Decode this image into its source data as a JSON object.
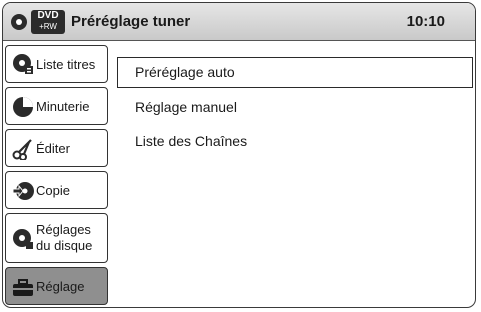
{
  "header": {
    "logo_top": "DVD",
    "logo_bottom": "+RW",
    "title": "Préréglage tuner",
    "time": "10:10"
  },
  "sidebar": {
    "items": [
      {
        "label": "Liste titres",
        "icon": "title-list-icon"
      },
      {
        "label": "Minuterie",
        "icon": "timer-icon"
      },
      {
        "label": "Éditer",
        "icon": "scissors-icon"
      },
      {
        "label": "Copie",
        "icon": "copy-icon"
      },
      {
        "label": "Réglages du disque",
        "label_line1": "Réglages",
        "label_line2": "du disque",
        "icon": "disc-settings-icon"
      },
      {
        "label": "Réglage",
        "icon": "toolbox-icon",
        "selected": true
      }
    ]
  },
  "menu": {
    "options": [
      {
        "label": "Préréglage auto",
        "selected": true
      },
      {
        "label": "Réglage manuel"
      },
      {
        "label": "Liste des Chaînes"
      }
    ]
  }
}
